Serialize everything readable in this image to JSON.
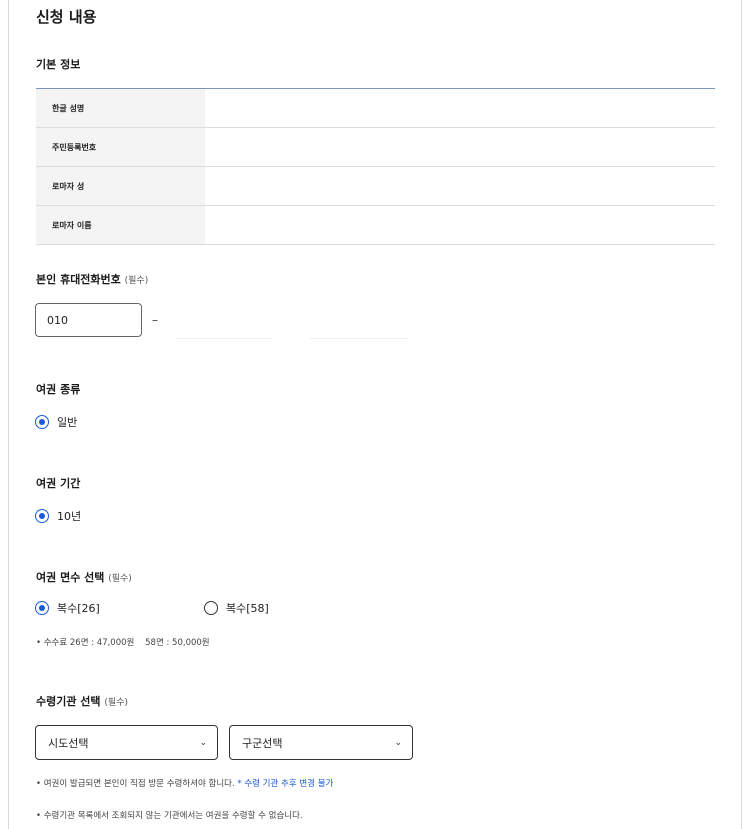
{
  "page": {
    "title": "신청 내용"
  },
  "basic_info": {
    "title": "기본 정보",
    "rows": [
      {
        "label": "한글 성명",
        "value": ""
      },
      {
        "label": "주민등록번호",
        "value": ""
      },
      {
        "label": "로마자 성",
        "value": ""
      },
      {
        "label": "로마자 이름",
        "value": ""
      }
    ]
  },
  "phone": {
    "title": "본인 휴대전화번호",
    "required": "(필수)",
    "prefix_value": "010",
    "separator": "–",
    "middle_value": "",
    "last_value": ""
  },
  "passport_type": {
    "title": "여권 종류",
    "options": [
      {
        "label": "일반",
        "checked": true
      }
    ]
  },
  "passport_period": {
    "title": "여권 기간",
    "options": [
      {
        "label": "10년",
        "checked": true
      }
    ]
  },
  "pages_select": {
    "title": "여권 면수 선택",
    "required": "(필수)",
    "options": [
      {
        "label": "복수[26]",
        "checked": true
      },
      {
        "label": "복수[58]",
        "checked": false
      }
    ],
    "fee_note": "• 수수료 26면 : 47,000원    58면 : 50,000원"
  },
  "agency_select": {
    "title": "수령기관 선택",
    "required": "(필수)",
    "province": {
      "value": "시도선택"
    },
    "district": {
      "value": "구군선택"
    },
    "note1_prefix": "• 여권이 발급되면 본인이 직접 방문 수령하셔야 합니다.",
    "note1_accent": "* 수령 기관 추후 변경 불가",
    "note2": "• 수령기관 목록에서 조회되지 않는 기관에서는 여권을 수령할 수 없습니다."
  },
  "colors": {
    "accent": "#1a5ad6",
    "table_border": "#7a94c4",
    "table_header_bg": "#f4f4f5"
  },
  "icons": {
    "dropdown": "chevron-down-icon"
  }
}
